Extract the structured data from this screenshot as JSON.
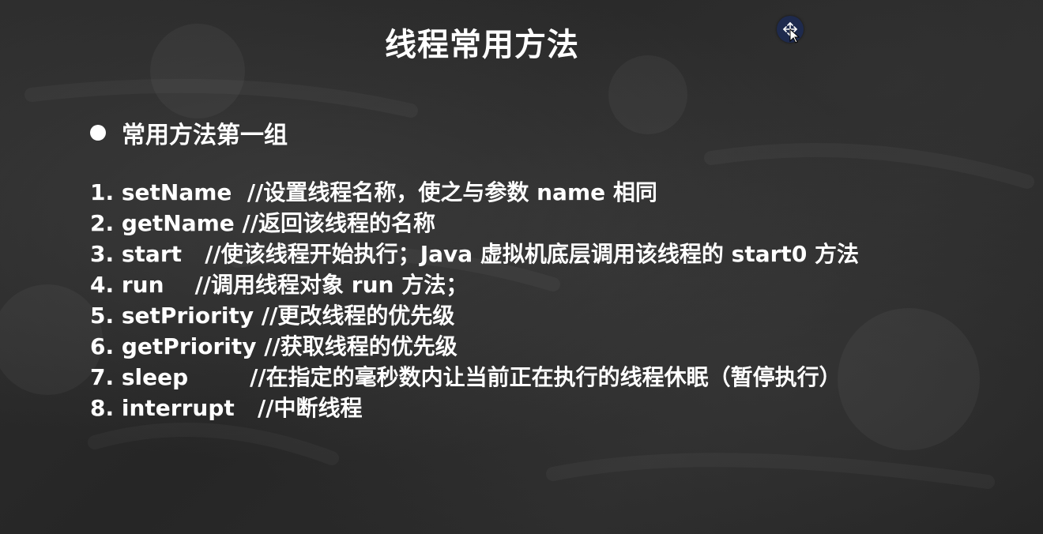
{
  "slide": {
    "title": "线程常用方法",
    "section_heading": "常用方法第一组",
    "methods": [
      {
        "num": "1.",
        "name": "setName",
        "gap": "  ",
        "comment": "//设置线程名称，使之与参数 name 相同"
      },
      {
        "num": "2.",
        "name": "getName",
        "gap": " ",
        "comment": "//返回该线程的名称"
      },
      {
        "num": "3.",
        "name": "start",
        "gap": "   ",
        "comment": "//使该线程开始执行；Java 虚拟机底层调用该线程的 start0 方法"
      },
      {
        "num": "4.",
        "name": "run",
        "gap": "    ",
        "comment": "//调用线程对象 run 方法；"
      },
      {
        "num": "5.",
        "name": "setPriority",
        "gap": " ",
        "comment": "//更改线程的优先级"
      },
      {
        "num": "6.",
        "name": "getPriority",
        "gap": " ",
        "comment": "//获取线程的优先级"
      },
      {
        "num": "7.",
        "name": "sleep",
        "gap": "        ",
        "comment": "//在指定的毫秒数内让当前正在执行的线程休眠（暂停执行）"
      },
      {
        "num": "8.",
        "name": "interrupt",
        "gap": "   ",
        "comment": "//中断线程"
      }
    ]
  },
  "overlay": {
    "cursor_icon": "move-cursor-icon",
    "badge_color": "#1e2a4d"
  },
  "colors": {
    "text": "#ffffff",
    "background": "#2a2a2a"
  }
}
